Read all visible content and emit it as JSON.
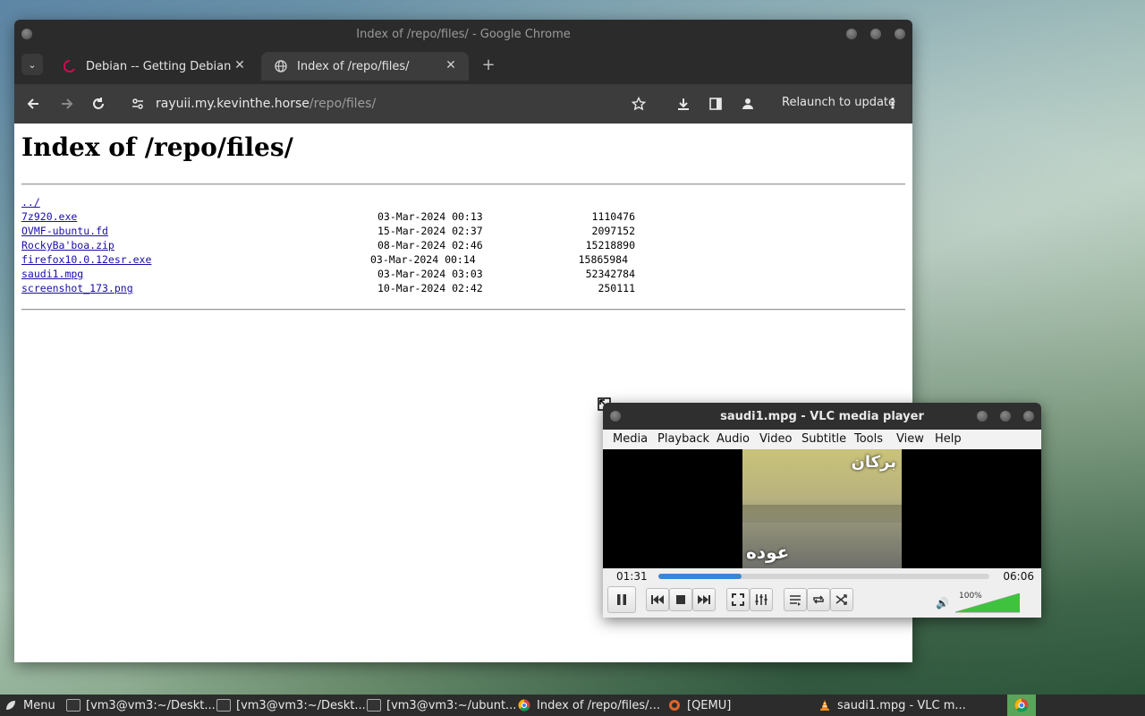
{
  "chrome": {
    "window_title": "Index of /repo/files/ - Google Chrome",
    "tabs": [
      {
        "label": "Debian -- Getting Debian",
        "icon": "debian-icon",
        "active": false
      },
      {
        "label": "Index of /repo/files/",
        "icon": "globe-icon",
        "active": true
      }
    ],
    "close_glyph": "✕",
    "new_tab_glyph": "+",
    "tab_menu_glyph": "⌄",
    "address": {
      "host": "rayuii.my.kevinthe.horse",
      "path": "/repo/files/"
    },
    "relaunch_label": "Relaunch to update",
    "kebab_glyph": "⋮"
  },
  "page": {
    "heading": "Index of /repo/files/",
    "parent_link": "../",
    "files": [
      {
        "name": "7z920.exe",
        "date": "03-Mar-2024 00:13",
        "size": "1110476"
      },
      {
        "name": "OVMF-ubuntu.fd",
        "date": "15-Mar-2024 02:37",
        "size": "2097152"
      },
      {
        "name": "RockyBa'boa.zip",
        "date": "08-Mar-2024 02:46",
        "size": "15218890"
      },
      {
        "name": "firefox10.0.12esr.exe",
        "date": "03-Mar-2024 00:14",
        "size": "15865984"
      },
      {
        "name": "saudi1.mpg",
        "date": "03-Mar-2024 03:03",
        "size": "52342784"
      },
      {
        "name": "screenshot_173.png",
        "date": "10-Mar-2024 02:42",
        "size": "250111"
      }
    ]
  },
  "vlc": {
    "window_title": "saudi1.mpg - VLC media player",
    "menu": [
      "Media",
      "Playback",
      "Audio",
      "Video",
      "Subtitle",
      "Tools",
      "View",
      "Help"
    ],
    "time_elapsed": "01:31",
    "time_total": "06:06",
    "progress_fraction": 0.25,
    "volume_label": "100%",
    "volume_fraction": 1.0,
    "video_overlay_top": "بركان",
    "video_overlay_bottom": "عوده",
    "accent_color": "#3d86d6"
  },
  "taskbar": {
    "menu_label": "Menu",
    "items": [
      {
        "label": "[vm3@vm3:~/Deskt...",
        "icon": "terminal-icon"
      },
      {
        "label": "[vm3@vm3:~/Deskt...",
        "icon": "terminal-icon"
      },
      {
        "label": "[vm3@vm3:~/ubunt...",
        "icon": "terminal-icon"
      },
      {
        "label": "Index of /repo/files/...",
        "icon": "chrome-icon"
      },
      {
        "label": "[QEMU]",
        "icon": "qemu-icon"
      },
      {
        "label": "saudi1.mpg - VLC m...",
        "icon": "vlc-icon"
      }
    ]
  }
}
